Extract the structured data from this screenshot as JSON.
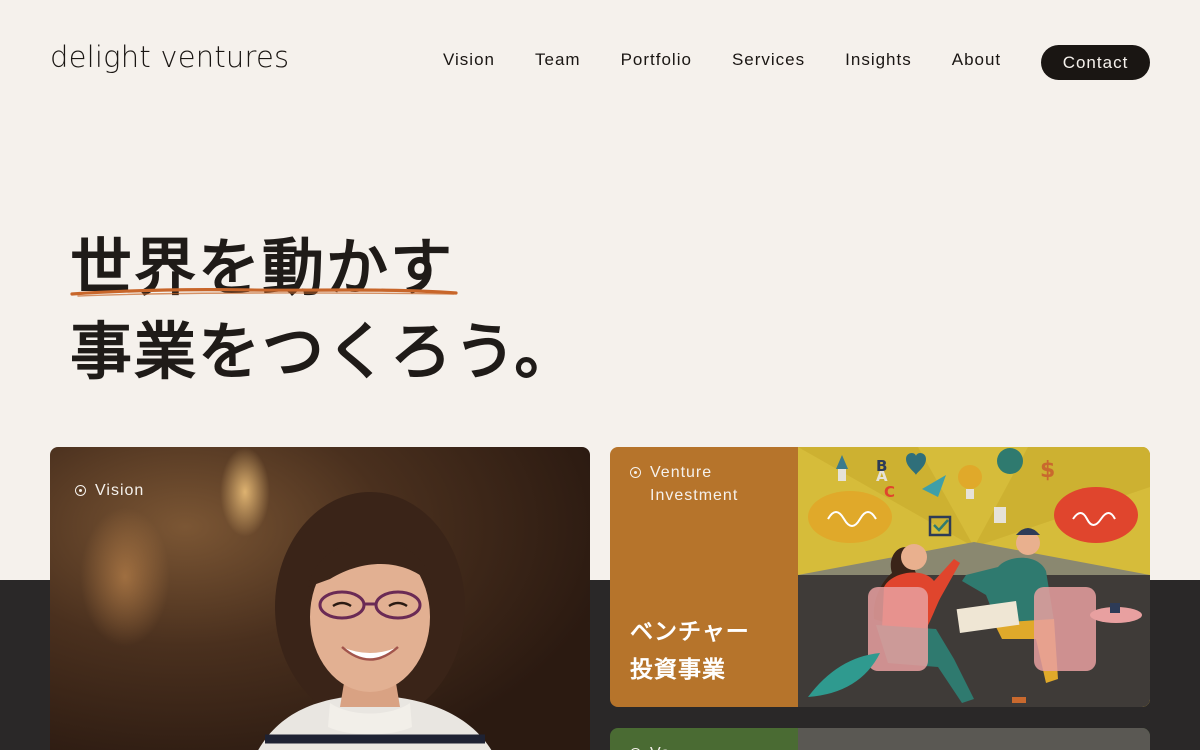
{
  "header": {
    "logo": "delight ventures",
    "nav": [
      "Vision",
      "Team",
      "Portfolio",
      "Services",
      "Insights",
      "About"
    ],
    "contact_label": "Contact"
  },
  "hero": {
    "line1": "世界を動かす",
    "line2": "事業をつくろう。",
    "underline_color": "#c8662a"
  },
  "cards": {
    "vision": {
      "tag": "Vision",
      "tag_icon": "circle-dot-icon"
    },
    "venture": {
      "tag_line1": "Venture",
      "tag_line2": "Investment",
      "title_line1": "ベンチャー",
      "title_line2": "投資事業",
      "tag_icon": "circle-dot-icon",
      "accent": "#b6742b"
    },
    "next": {
      "tag": "Ve",
      "accent": "#4a6b33"
    }
  },
  "illustration": {
    "letters": [
      "A",
      "B",
      "C",
      "$"
    ]
  },
  "colors": {
    "background": "#f5f1ec",
    "dark_band": "#2a2828",
    "text": "#1a1613"
  }
}
